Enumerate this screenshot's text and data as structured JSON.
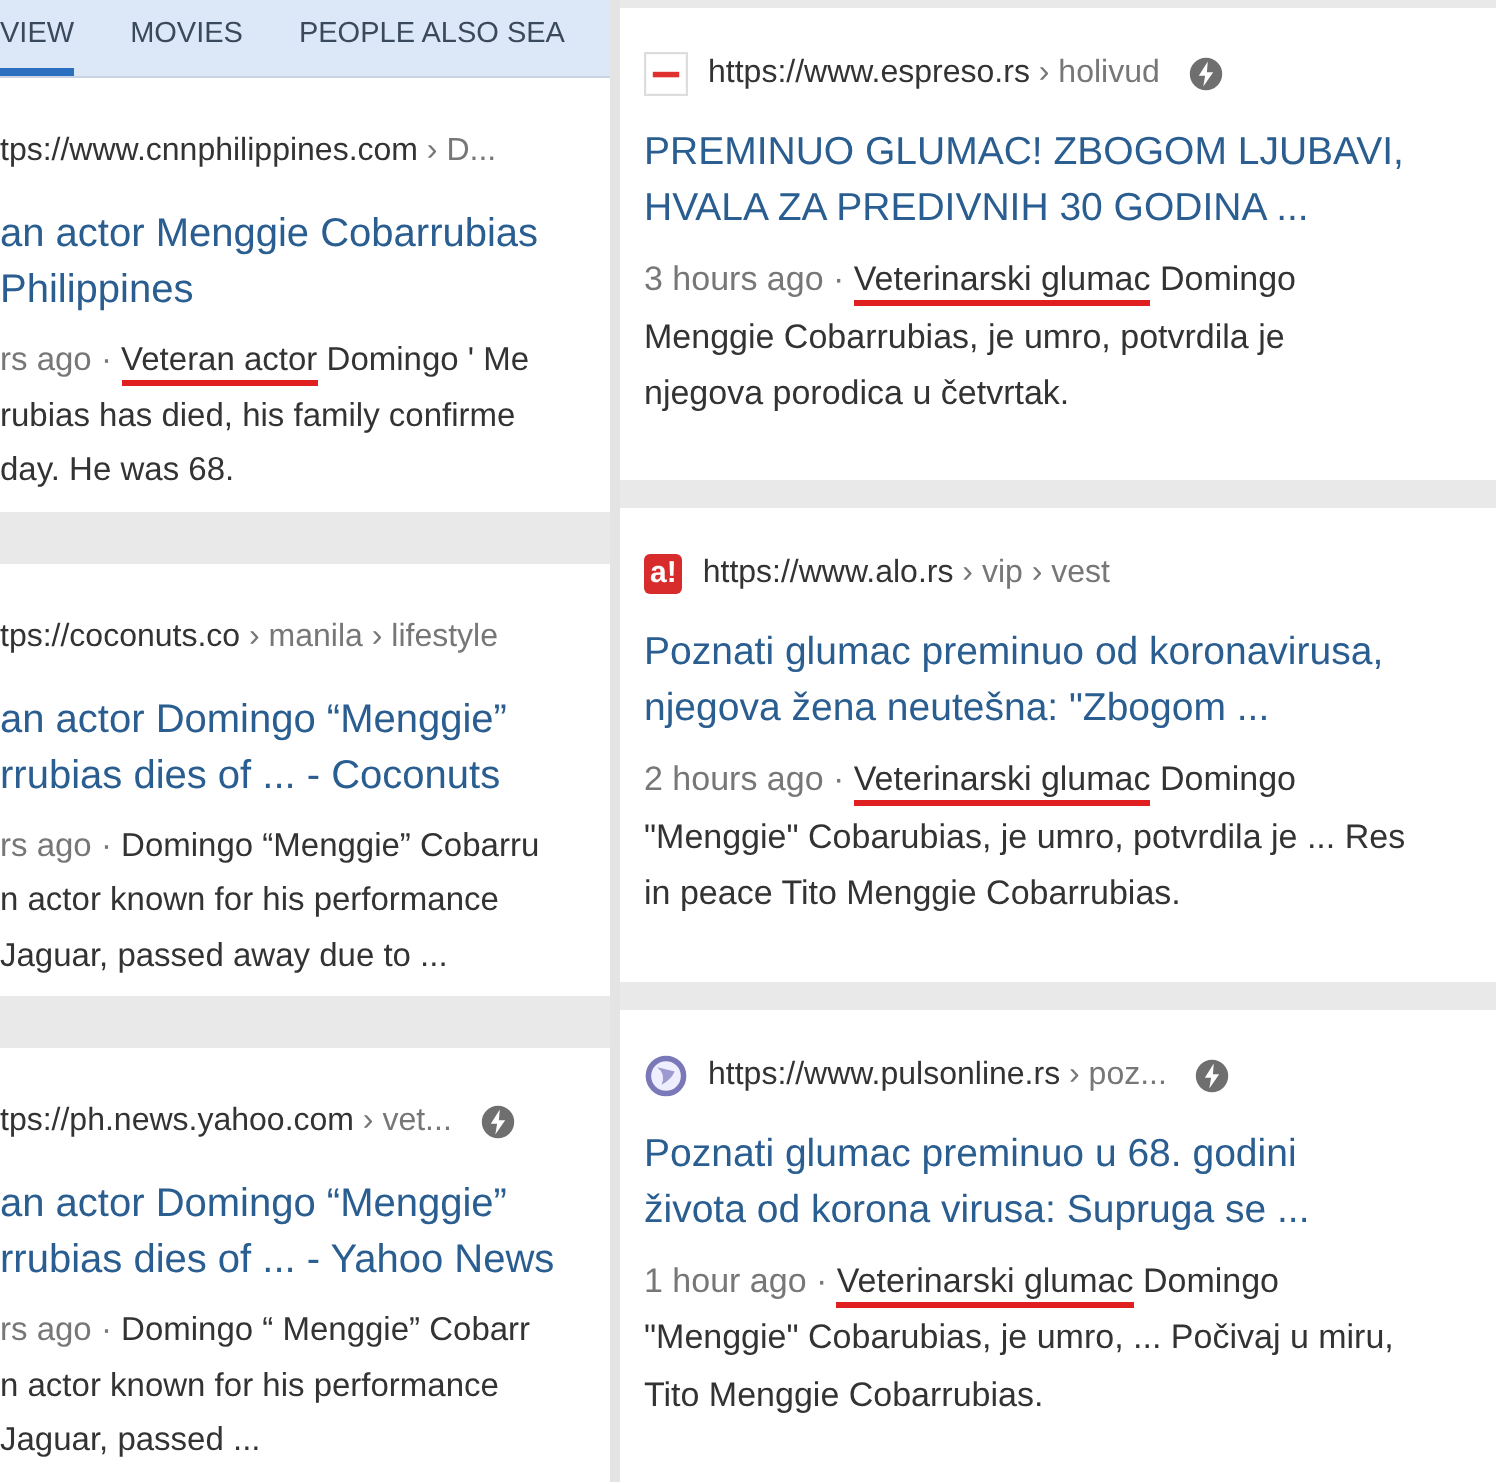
{
  "left": {
    "tabs": [
      {
        "label": "VIEW",
        "selected": true
      },
      {
        "label": "MOVIES",
        "selected": false
      },
      {
        "label": "PEOPLE ALSO SEA",
        "selected": false
      }
    ],
    "results": [
      {
        "url": "tps://www.cnnphilippines.com",
        "path": " › D...",
        "amp": false,
        "title": [
          "an actor Menggie Cobarrubias",
          "Philippines"
        ],
        "snippet": [
          [
            {
              "kind": "date",
              "text": "rs ago · "
            },
            {
              "kind": "marked",
              "text": "Veteran actor"
            },
            {
              "kind": "plain",
              "text": " Domingo ' Me"
            }
          ],
          [
            {
              "kind": "plain",
              "text": "rubias has died, his family confirme"
            }
          ],
          [
            {
              "kind": "plain",
              "text": "day. He was 68."
            }
          ]
        ]
      },
      {
        "url": "tps://coconuts.co",
        "path": " › manila › lifestyle",
        "amp": false,
        "title": [
          "an actor Domingo “Menggie”",
          "rrubias dies of ... - Coconuts"
        ],
        "snippet": [
          [
            {
              "kind": "date",
              "text": "rs ago · "
            },
            {
              "kind": "plain",
              "text": "Domingo “Menggie” Cobarru"
            }
          ],
          [
            {
              "kind": "plain",
              "text": "n actor known for his performance"
            }
          ],
          [
            {
              "kind": "plain",
              "text": "Jaguar, passed away due to ..."
            }
          ]
        ]
      },
      {
        "url": "tps://ph.news.yahoo.com",
        "path": " › vet...",
        "amp": true,
        "title": [
          "an actor Domingo “Menggie”",
          "rrubias dies of ... - Yahoo News"
        ],
        "snippet": [
          [
            {
              "kind": "date",
              "text": "rs ago · "
            },
            {
              "kind": "plain",
              "text": "Domingo “ Menggie” Cobarr"
            }
          ],
          [
            {
              "kind": "plain",
              "text": "n actor known for his performance"
            }
          ],
          [
            {
              "kind": "plain",
              "text": "Jaguar, passed ..."
            }
          ]
        ]
      }
    ]
  },
  "right": {
    "results": [
      {
        "favicon": {
          "kind": "stripe"
        },
        "url": "https://www.espreso.rs",
        "path": " › holivud",
        "amp": true,
        "title": [
          "PREMINUO GLUMAC! ZBOGOM LJUBAVI,",
          "HVALA ZA PREDIVNIH 30 GODINA ..."
        ],
        "snippet": [
          [
            {
              "kind": "date",
              "text": "3 hours ago · "
            },
            {
              "kind": "marked",
              "text": "Veterinarski glumac"
            },
            {
              "kind": "plain",
              "text": " Domingo"
            }
          ],
          [
            {
              "kind": "plain",
              "text": "Menggie Cobarrubias, je umro, potvrdila je"
            }
          ],
          [
            {
              "kind": "plain",
              "text": "njegova porodica u četvrtak."
            }
          ]
        ]
      },
      {
        "favicon": {
          "kind": "badge",
          "text": "a!"
        },
        "url": "https://www.alo.rs",
        "path": " › vip › vest",
        "amp": false,
        "title": [
          "Poznati glumac preminuo od koronavirusa,",
          "njegova žena neutešna: \"Zbogom ..."
        ],
        "snippet": [
          [
            {
              "kind": "date",
              "text": "2 hours ago · "
            },
            {
              "kind": "marked",
              "text": "Veterinarski glumac"
            },
            {
              "kind": "plain",
              "text": " Domingo"
            }
          ],
          [
            {
              "kind": "plain",
              "text": "\"Menggie\" Cobarubias, je umro, potvrdila je ... Res"
            }
          ],
          [
            {
              "kind": "plain",
              "text": "in peace Tito Menggie Cobarrubias."
            }
          ]
        ]
      },
      {
        "favicon": {
          "kind": "globe"
        },
        "url": "https://www.pulsonline.rs",
        "path": " › poz...",
        "amp": true,
        "title": [
          "Poznati glumac preminuo u 68. godini",
          "života od korona virusa: Supruga se ..."
        ],
        "snippet": [
          [
            {
              "kind": "date",
              "text": "1 hour ago · "
            },
            {
              "kind": "marked",
              "text": "Veterinarski glumac"
            },
            {
              "kind": "plain",
              "text": " Domingo"
            }
          ],
          [
            {
              "kind": "plain",
              "text": "\"Menggie\" Cobarubias, je umro, ... Počivaj u miru,"
            }
          ],
          [
            {
              "kind": "plain",
              "text": "Tito Menggie Cobarrubias."
            }
          ]
        ]
      }
    ]
  }
}
